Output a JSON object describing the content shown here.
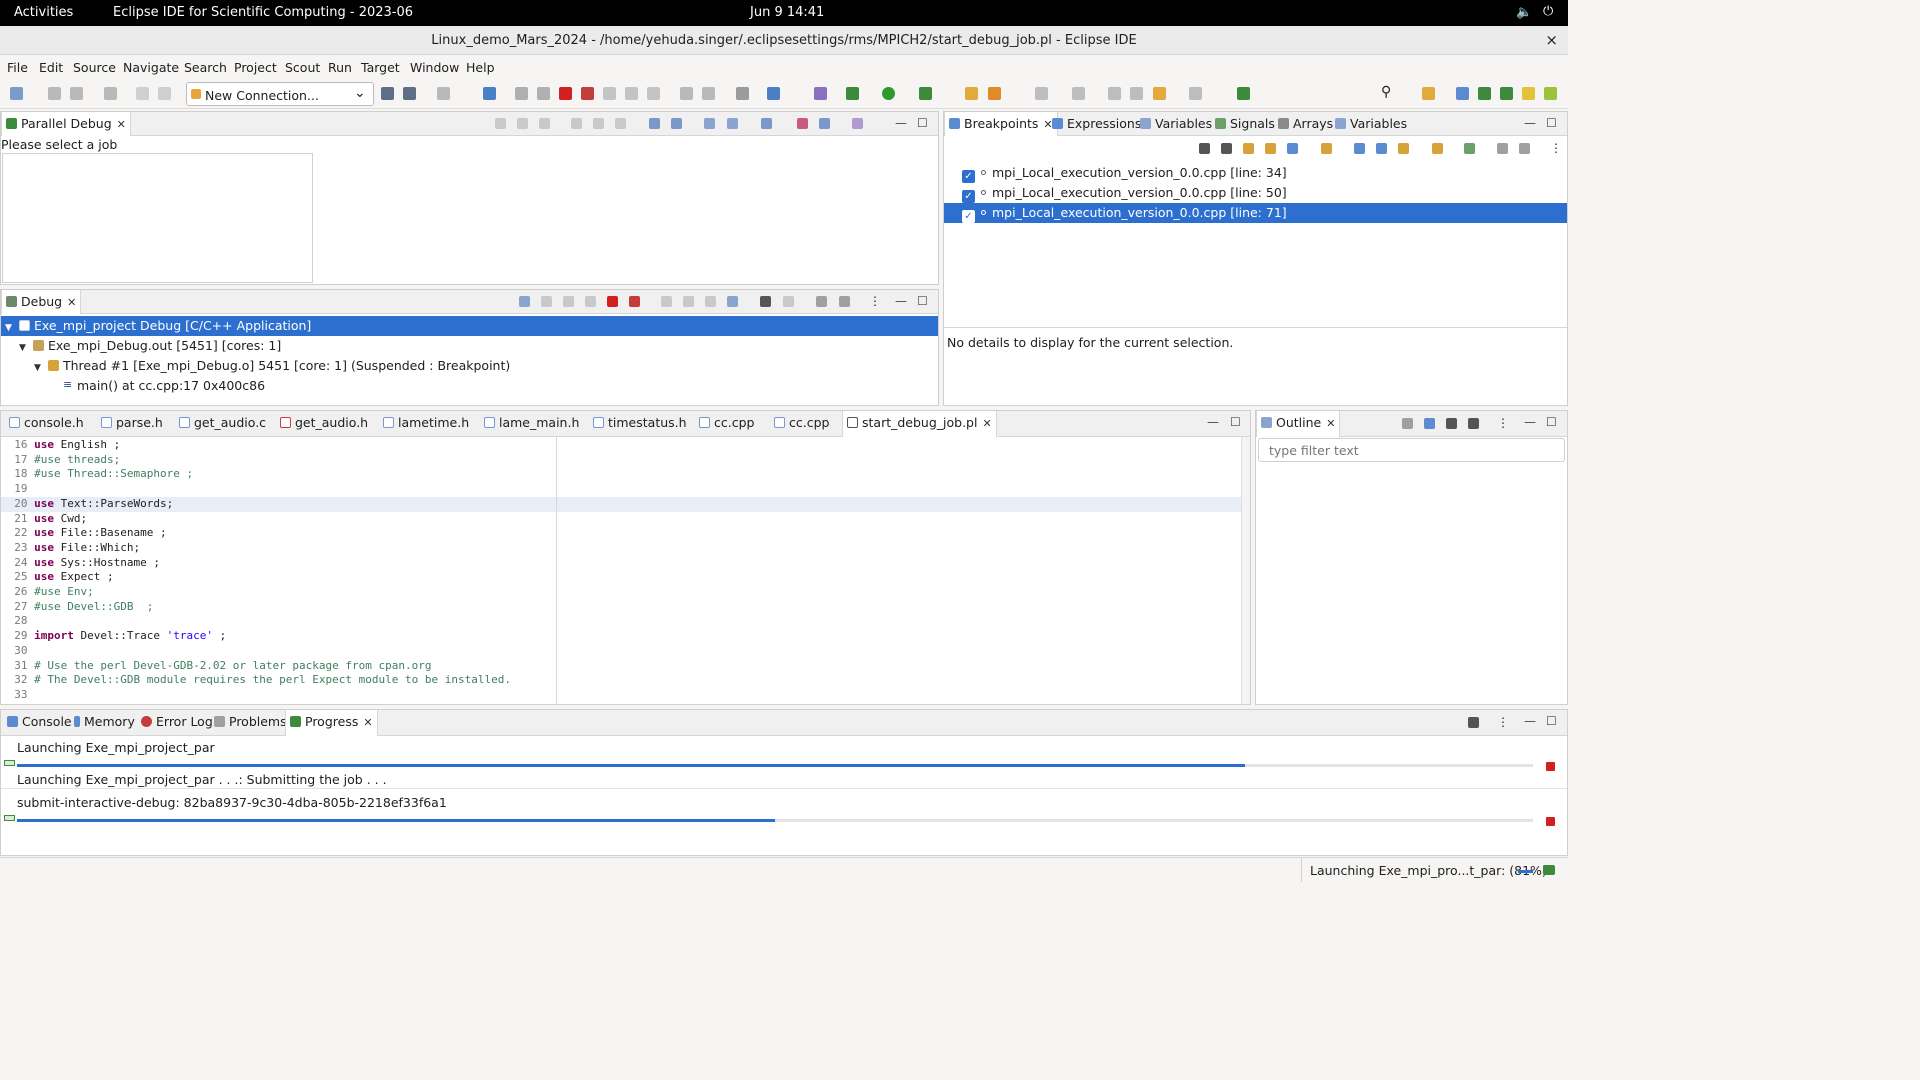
{
  "topbar": {
    "activities": "Activities",
    "app_name": "Eclipse IDE for Scientific Computing - 2023-06",
    "clock": "Jun 9  14:41"
  },
  "window": {
    "title": "Linux_demo_Mars_2024 - /home/yehuda.singer/.eclipsesettings/rms/MPICH2/start_debug_job.pl - Eclipse IDE",
    "close": "×"
  },
  "menu": [
    "File",
    "Edit",
    "Source",
    "Navigate",
    "Search",
    "Project",
    "Scout",
    "Run",
    "Target",
    "Window",
    "Help"
  ],
  "toolbar": {
    "connection_combo": "New Connection..."
  },
  "parallel_debug": {
    "tab": "Parallel Debug",
    "message": "Please select a job"
  },
  "breakpoints_panel": {
    "tabs": [
      "Breakpoints",
      "Expressions",
      "Variables",
      "Signals",
      "Arrays",
      "Variables"
    ],
    "items": [
      "mpi_Local_execution_version_0.0.cpp [line: 34]",
      "mpi_Local_execution_version_0.0.cpp [line: 50]",
      "mpi_Local_execution_version_0.0.cpp [line: 71]"
    ],
    "details": "No details to display for the current selection."
  },
  "debug": {
    "tab": "Debug",
    "tree": [
      "Exe_mpi_project Debug [C/C++ Application]",
      "Exe_mpi_Debug.out [5451] [cores: 1]",
      "Thread #1 [Exe_mpi_Debug.o] 5451 [core: 1] (Suspended : Breakpoint)",
      "main() at cc.cpp:17 0x400c86"
    ]
  },
  "editor": {
    "tabs": [
      "console.h",
      "parse.h",
      "get_audio.c",
      "get_audio.h",
      "lametime.h",
      "lame_main.h",
      "timestatus.h",
      "cc.cpp",
      "cc.cpp",
      "start_debug_job.pl"
    ],
    "lines": [
      {
        "n": "16",
        "parts": [
          {
            "c": "kw",
            "t": "use"
          },
          {
            "c": "",
            "t": " English ;"
          }
        ]
      },
      {
        "n": "17",
        "parts": [
          {
            "c": "cm",
            "t": "#use threads;"
          }
        ]
      },
      {
        "n": "18",
        "parts": [
          {
            "c": "cm",
            "t": "#use Thread::Semaphore ;"
          }
        ]
      },
      {
        "n": "19",
        "parts": []
      },
      {
        "n": "20",
        "parts": [
          {
            "c": "kw",
            "t": "use"
          },
          {
            "c": "",
            "t": " Text::ParseWords;"
          }
        ]
      },
      {
        "n": "21",
        "parts": [
          {
            "c": "kw",
            "t": "use"
          },
          {
            "c": "",
            "t": " Cwd;"
          }
        ]
      },
      {
        "n": "22",
        "parts": [
          {
            "c": "kw",
            "t": "use"
          },
          {
            "c": "",
            "t": " File::Basename ;"
          }
        ]
      },
      {
        "n": "23",
        "parts": [
          {
            "c": "kw",
            "t": "use"
          },
          {
            "c": "",
            "t": " File::Which;"
          }
        ]
      },
      {
        "n": "24",
        "parts": [
          {
            "c": "kw",
            "t": "use"
          },
          {
            "c": "",
            "t": " Sys::Hostname ;"
          }
        ]
      },
      {
        "n": "25",
        "parts": [
          {
            "c": "kw",
            "t": "use"
          },
          {
            "c": "",
            "t": " Expect ;"
          }
        ]
      },
      {
        "n": "26",
        "parts": [
          {
            "c": "cm",
            "t": "#use Env;"
          }
        ]
      },
      {
        "n": "27",
        "parts": [
          {
            "c": "cm",
            "t": "#use Devel::GDB  ;"
          }
        ]
      },
      {
        "n": "28",
        "parts": []
      },
      {
        "n": "29",
        "parts": [
          {
            "c": "kw",
            "t": "import"
          },
          {
            "c": "",
            "t": " Devel::Trace "
          },
          {
            "c": "st",
            "t": "'trace'"
          },
          {
            "c": "",
            "t": " ;"
          }
        ]
      },
      {
        "n": "30",
        "parts": []
      },
      {
        "n": "31",
        "parts": [
          {
            "c": "cm",
            "t": "# Use the perl Devel-GDB-2.02 or later package from cpan.org"
          }
        ]
      },
      {
        "n": "32",
        "parts": [
          {
            "c": "cm",
            "t": "# The Devel::GDB module requires the perl Expect module to be installed."
          }
        ]
      },
      {
        "n": "33",
        "parts": []
      }
    ]
  },
  "outline": {
    "tab": "Outline",
    "filter_placeholder": "type filter text"
  },
  "bottom": {
    "tabs": [
      "Console",
      "Memory",
      "Error Log",
      "Problems",
      "Progress"
    ],
    "jobs": [
      {
        "title": "Launching Exe_mpi_project_par",
        "progress": 0.81
      },
      {
        "title": "Launching Exe_mpi_project_par . . .: Submitting the job . . .",
        "progress": null
      },
      {
        "title": "submit-interactive-debug: 82ba8937-9c30-4dba-805b-2218ef33f6a1",
        "progress": 0.5
      }
    ]
  },
  "statusbar": {
    "text": "Launching Exe_mpi_pro...t_par: (81%)"
  },
  "colors": {
    "accent": "#2c6fcf",
    "stop": "#d21f1f",
    "keyword": "#7f0055",
    "comment": "#3f7f5f"
  }
}
